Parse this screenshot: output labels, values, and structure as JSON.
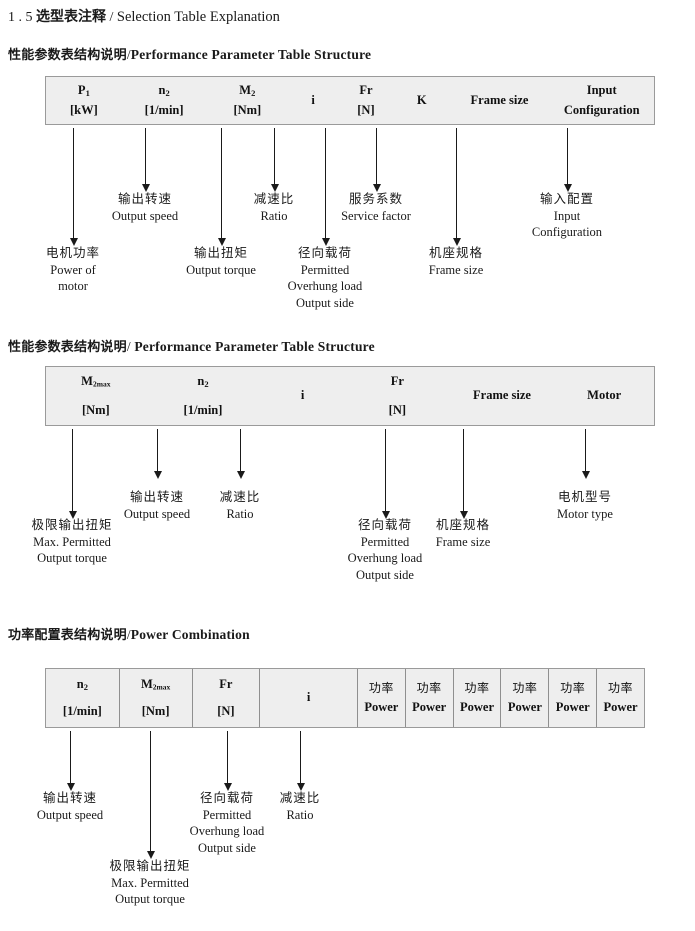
{
  "document": {
    "section_number": "1 . 5",
    "title_cn": "选型表注释",
    "title_sep": "/",
    "title_en": "Selection Table Explanation"
  },
  "sections": [
    {
      "id": "performance-parameter-1",
      "heading_cn": "性能参数表结构说明",
      "heading_sep": "/",
      "heading_en": "Performance Parameter Table Structure",
      "table": {
        "divided": false,
        "columns": [
          {
            "name": "p1",
            "line1": "P",
            "sub1": "1",
            "line2": "[kW]"
          },
          {
            "name": "n2",
            "line1": "n",
            "sub1": "2",
            "line2": "[1/min]"
          },
          {
            "name": "m2",
            "line1": "M",
            "sub1": "2",
            "line2": "[Nm]"
          },
          {
            "name": "i",
            "line1": "i",
            "sub1": "",
            "line2": ""
          },
          {
            "name": "fr",
            "line1": "Fr",
            "sub1": "",
            "line2": "[N]"
          },
          {
            "name": "k",
            "line1": "K",
            "sub1": "",
            "line2": ""
          },
          {
            "name": "frame",
            "line1": "Frame size",
            "sub1": "",
            "line2": ""
          },
          {
            "name": "input",
            "line1": "Input",
            "sub1": "",
            "line2": "Configuration"
          }
        ]
      },
      "annotations": [
        {
          "name": "power-of-motor",
          "cn": "电机功率",
          "en": [
            "Power of",
            "motor"
          ]
        },
        {
          "name": "output-speed",
          "cn": "输出转速",
          "en": [
            "Output speed"
          ]
        },
        {
          "name": "output-torque",
          "cn": "输出扭矩",
          "en": [
            "Output torque"
          ]
        },
        {
          "name": "ratio",
          "cn": "减速比",
          "en": [
            "Ratio"
          ]
        },
        {
          "name": "overhung-load",
          "cn": "径向载荷",
          "en": [
            "Permitted",
            "Overhung load",
            "Output side"
          ]
        },
        {
          "name": "service-factor",
          "cn": "服务系数",
          "en": [
            "Service factor"
          ]
        },
        {
          "name": "frame-size",
          "cn": "机座规格",
          "en": [
            "Frame size"
          ]
        },
        {
          "name": "input-configuration",
          "cn": "输入配置",
          "en": [
            "Input",
            "Configuration"
          ]
        }
      ]
    },
    {
      "id": "performance-parameter-2",
      "heading_cn": "性能参数表结构说明",
      "heading_sep": "/",
      "heading_en": "Performance Parameter Table Structure",
      "table": {
        "divided": false,
        "columns": [
          {
            "name": "m2max",
            "line1": "M",
            "sub1": "2max",
            "line2": "[Nm]"
          },
          {
            "name": "n2",
            "line1": "n",
            "sub1": "2",
            "line2": "[1/min]"
          },
          {
            "name": "i",
            "line1": "i",
            "sub1": "",
            "line2": ""
          },
          {
            "name": "fr",
            "line1": "Fr",
            "sub1": "",
            "line2": "[N]"
          },
          {
            "name": "frame",
            "line1": "Frame size",
            "sub1": "",
            "line2": ""
          },
          {
            "name": "motor",
            "line1": "Motor",
            "sub1": "",
            "line2": ""
          }
        ]
      },
      "annotations": [
        {
          "name": "max-permitted-output-torque",
          "cn": "极限输出扭矩",
          "en": [
            "Max. Permitted",
            "Output  torque"
          ]
        },
        {
          "name": "output-speed",
          "cn": "输出转速",
          "en": [
            "Output speed"
          ]
        },
        {
          "name": "ratio",
          "cn": "减速比",
          "en": [
            "Ratio"
          ]
        },
        {
          "name": "overhung-load",
          "cn": "径向载荷",
          "en": [
            "Permitted",
            "Overhung load",
            "Output side"
          ]
        },
        {
          "name": "frame-size",
          "cn": "机座规格",
          "en": [
            "Frame size"
          ]
        },
        {
          "name": "motor-type",
          "cn": "电机型号",
          "en": [
            "Motor type"
          ]
        }
      ]
    },
    {
      "id": "power-combination",
      "heading_cn": "功率配置表结构说明",
      "heading_sep": "/",
      "heading_en": "Power Combination",
      "table": {
        "divided": true,
        "columns": [
          {
            "name": "n2",
            "line1": "n",
            "sub1": "2",
            "line2": "[1/min]"
          },
          {
            "name": "m2max",
            "line1": "M",
            "sub1": "2max",
            "line2": "[Nm]"
          },
          {
            "name": "fr",
            "line1": "Fr",
            "sub1": "",
            "line2": "[N]"
          },
          {
            "name": "i",
            "line1": "i",
            "sub1": "",
            "line2": ""
          },
          {
            "name": "power-1",
            "cn": "功率",
            "en": "Power"
          },
          {
            "name": "power-2",
            "cn": "功率",
            "en": "Power"
          },
          {
            "name": "power-3",
            "cn": "功率",
            "en": "Power"
          },
          {
            "name": "power-4",
            "cn": "功率",
            "en": "Power"
          },
          {
            "name": "power-5",
            "cn": "功率",
            "en": "Power"
          },
          {
            "name": "power-6",
            "cn": "功率",
            "en": "Power"
          }
        ]
      },
      "annotations": [
        {
          "name": "output-speed",
          "cn": "输出转速",
          "en": [
            "Output speed"
          ]
        },
        {
          "name": "max-permitted-output-torque",
          "cn": "极限输出扭矩",
          "en": [
            "Max. Permitted",
            "Output  torque"
          ]
        },
        {
          "name": "overhung-load",
          "cn": "径向载荷",
          "en": [
            "Permitted",
            "Overhung load",
            "Output side"
          ]
        },
        {
          "name": "ratio",
          "cn": "减速比",
          "en": [
            "Ratio"
          ]
        }
      ]
    }
  ],
  "colors": {
    "table_fill": "#eeeeee",
    "table_border": "#9a9a9a",
    "text": "#1a1a1a"
  }
}
